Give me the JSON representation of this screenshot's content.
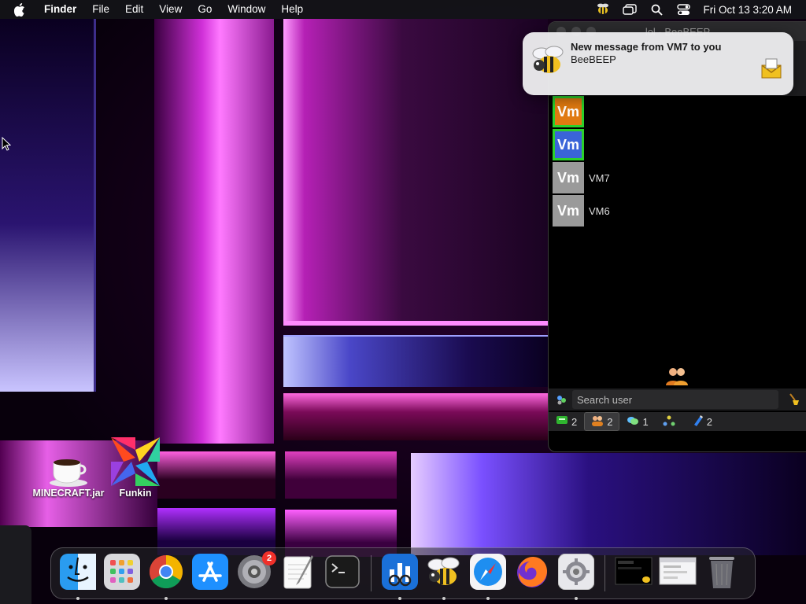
{
  "menubar": {
    "apple_icon": "apple-logo",
    "app_name": "Finder",
    "items": [
      "File",
      "Edit",
      "View",
      "Go",
      "Window",
      "Help"
    ],
    "status_icons": [
      "beebeep-icon",
      "stage-manager-icon",
      "search-icon",
      "control-center-icon"
    ],
    "clock": "Fri Oct 13  3:20 AM"
  },
  "desktop": {
    "icons": [
      {
        "label": "MINECRAFT.jar",
        "icon": "java-coffee-icon"
      },
      {
        "label": "Funkin",
        "icon": "funkin-icon"
      }
    ]
  },
  "notification": {
    "title": "New message from VM7 to you",
    "subtitle": "BeeBEEP",
    "app_icon": "bee-icon",
    "attachment_icon": "mail-icon"
  },
  "beebeep_window": {
    "title": "lol - BeeBEEP",
    "users": [
      {
        "avatar_text": "Vm",
        "name": "",
        "avatar_color": "#e07a10",
        "border_color": "#2bd12b"
      },
      {
        "avatar_text": "Vm",
        "name": "",
        "avatar_color": "#3a64d8",
        "border_color": "#2bd12b"
      },
      {
        "avatar_text": "Vm",
        "name": "VM7",
        "avatar_color": "#9a9a9a",
        "border_color": "#9a9a9a"
      },
      {
        "avatar_text": "Vm",
        "name": "VM6",
        "avatar_color": "#9a9a9a",
        "border_color": "#9a9a9a"
      }
    ],
    "search_placeholder": "Search user",
    "tabs": [
      {
        "icon": "chat-icon",
        "count": "2"
      },
      {
        "icon": "users-icon",
        "count": "2"
      },
      {
        "icon": "groups-icon",
        "count": "1"
      },
      {
        "icon": "network-icon",
        "count": ""
      },
      {
        "icon": "files-icon",
        "count": "2"
      }
    ]
  },
  "dock": {
    "apps": [
      {
        "name": "Finder",
        "icon": "finder-icon",
        "running": true
      },
      {
        "name": "Launchpad",
        "icon": "launchpad-icon",
        "running": false
      },
      {
        "name": "Google Chrome",
        "icon": "chrome-icon",
        "running": true
      },
      {
        "name": "App Store",
        "icon": "app-store-icon",
        "running": false
      },
      {
        "name": "System Preferences",
        "icon": "system-preferences-icon",
        "running": false,
        "badge": "2"
      },
      {
        "name": "TextEdit",
        "icon": "textedit-icon",
        "running": false
      },
      {
        "name": "Terminal",
        "icon": "terminal-icon",
        "running": false
      }
    ],
    "recent": [
      {
        "name": "Geekbench",
        "icon": "geekbench-icon",
        "running": true
      },
      {
        "name": "BeeBEEP",
        "icon": "bee-icon",
        "running": true
      },
      {
        "name": "Safari",
        "icon": "safari-icon",
        "running": true
      },
      {
        "name": "Firefox",
        "icon": "firefox-icon",
        "running": false
      },
      {
        "name": "System Settings",
        "icon": "settings-gear-icon",
        "running": true
      }
    ],
    "trailing": [
      {
        "name": "Window thumbnail 1",
        "icon": "window-thumbnail-icon"
      },
      {
        "name": "Window thumbnail 2",
        "icon": "window-thumbnail-icon"
      },
      {
        "name": "Trash",
        "icon": "trash-icon"
      }
    ]
  }
}
